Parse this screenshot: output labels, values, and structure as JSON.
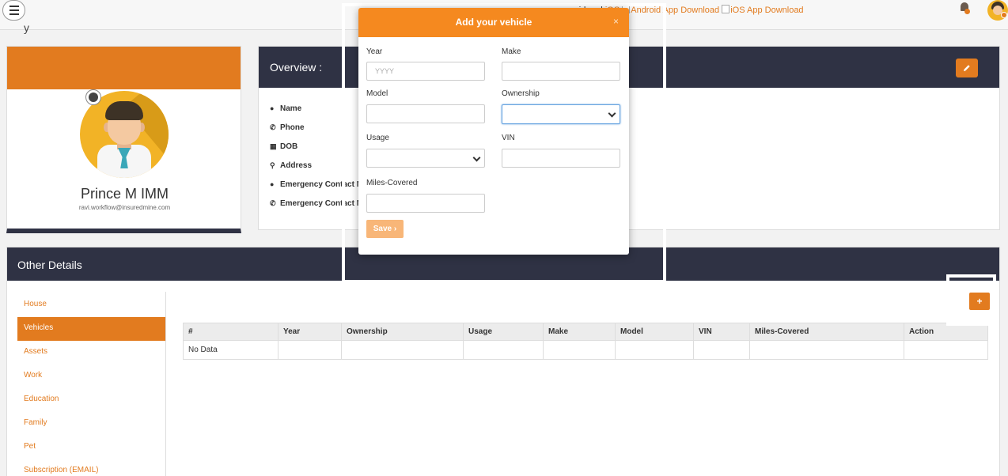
{
  "topbar": {
    "store_text_prefix": "roid and",
    "store_ios": "iOS",
    "android_alt": "Android App Download",
    "ios_alt": "iOS App Download"
  },
  "page": {
    "crumb": "y"
  },
  "profile": {
    "name": "Prince M IMM",
    "email": "ravi.workflow@insuredmine.com"
  },
  "overview": {
    "title": "Overview :",
    "rows": [
      {
        "icon": "user-icon",
        "label": "Name"
      },
      {
        "icon": "phone-icon",
        "label": "Phone"
      },
      {
        "icon": "calendar-icon",
        "label": "DOB"
      },
      {
        "icon": "map-marker-icon",
        "label": "Address"
      },
      {
        "icon": "user-icon",
        "label": "Emergency Contact N"
      },
      {
        "icon": "phone-icon",
        "label": "Emergency Contact N"
      }
    ]
  },
  "other": {
    "title": "Other Details",
    "sidebar": [
      "House",
      "Vehicles",
      "Assets",
      "Work",
      "Education",
      "Family",
      "Pet",
      "Subscription (EMAIL)"
    ],
    "active_index": 1,
    "add_label": "+",
    "table": {
      "headers": [
        "#",
        "Year",
        "Ownership",
        "Usage",
        "Make",
        "Model",
        "VIN",
        "Miles-Covered",
        "Action"
      ],
      "empty_text": "No Data"
    }
  },
  "modal": {
    "title": "Add your vehicle",
    "close": "×",
    "fields": {
      "year_label": "Year",
      "year_placeholder": "YYYY",
      "make_label": "Make",
      "model_label": "Model",
      "ownership_label": "Ownership",
      "usage_label": "Usage",
      "vin_label": "VIN",
      "miles_label": "Miles-Covered"
    },
    "save_label": "Save ›"
  },
  "annotations": {
    "one": "1",
    "two": "2"
  },
  "colors": {
    "accent": "#e27b1f",
    "header_dark": "#2f3244",
    "modal_header": "#f5891f"
  }
}
